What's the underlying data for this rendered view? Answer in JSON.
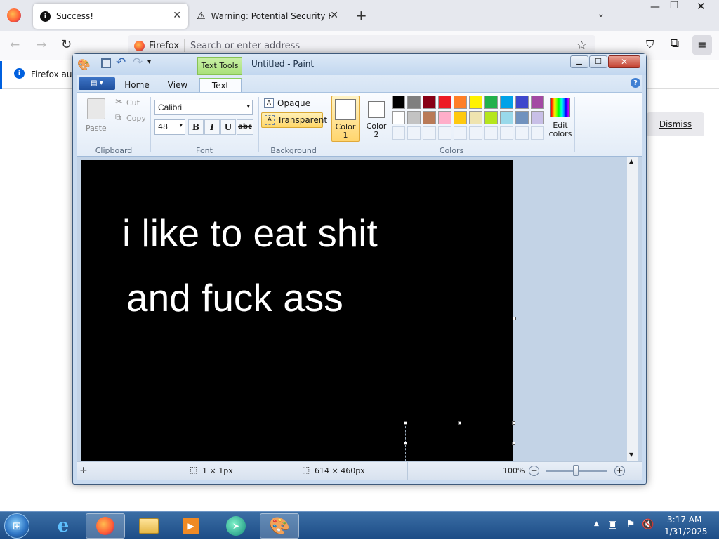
{
  "firefox": {
    "tabs": [
      {
        "title": "Success!",
        "icon": "info-icon"
      },
      {
        "title": "Warning: Potential Security Risk Ahead",
        "icon": "warning-icon"
      }
    ],
    "new_tab_symbol": "+",
    "url_identity": "Firefox",
    "url_placeholder": "Search or enter address",
    "notification_text": "Firefox automatically",
    "dismiss_label": "Dismiss"
  },
  "paint": {
    "window_title": "Untitled - Paint",
    "contextual_tab": "Text Tools",
    "tabs": [
      "Home",
      "View",
      "Text"
    ],
    "clipboard": {
      "paste": "Paste",
      "cut": "Cut",
      "copy": "Copy",
      "label": "Clipboard"
    },
    "font": {
      "family": "Calibri",
      "size": "48",
      "bold": "B",
      "italic": "I",
      "underline": "U",
      "strike": "abc",
      "label": "Font"
    },
    "background": {
      "opaque": "Opaque",
      "transparent": "Transparent",
      "label": "Background"
    },
    "colors": {
      "color1_label": "Color\n1",
      "color2_label": "Color\n2",
      "edit_label": "Edit\ncolors",
      "label": "Colors",
      "palette_row1": [
        "#000000",
        "#7f7f7f",
        "#880015",
        "#ed1c24",
        "#ff7f27",
        "#fff200",
        "#22b14c",
        "#00a2e8",
        "#3f48cc",
        "#a349a4"
      ],
      "palette_row2": [
        "#ffffff",
        "#c3c3c3",
        "#b97a57",
        "#ffaec9",
        "#ffc90e",
        "#efe4b0",
        "#b5e61d",
        "#99d9ea",
        "#7092be",
        "#c8bfe7"
      ]
    },
    "canvas_text": [
      "i like to eat shit",
      "and fuck ass"
    ],
    "status": {
      "cursor": "1 × 1px",
      "size": "614 × 460px",
      "zoom": "100%"
    }
  },
  "taskbar": {
    "time": "3:17 AM",
    "date": "1/31/2025"
  }
}
